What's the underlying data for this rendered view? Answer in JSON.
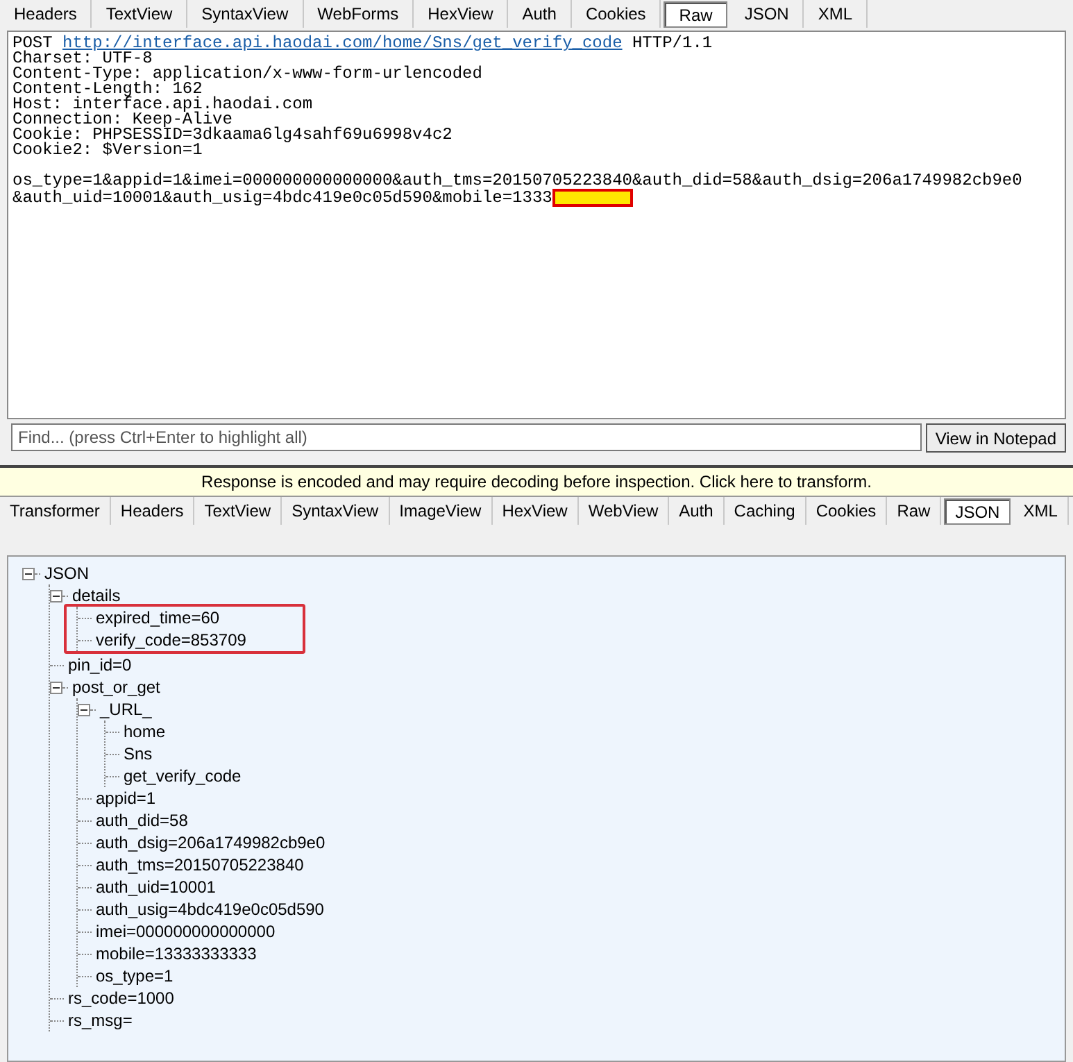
{
  "request_tabs": [
    {
      "label": "Headers",
      "selected": false
    },
    {
      "label": "TextView",
      "selected": false
    },
    {
      "label": "SyntaxView",
      "selected": false
    },
    {
      "label": "WebForms",
      "selected": false
    },
    {
      "label": "HexView",
      "selected": false
    },
    {
      "label": "Auth",
      "selected": false
    },
    {
      "label": "Cookies",
      "selected": false
    },
    {
      "label": "Raw",
      "selected": true
    },
    {
      "label": "JSON",
      "selected": false
    },
    {
      "label": "XML",
      "selected": false
    }
  ],
  "raw_request": {
    "method": "POST",
    "url": "http://interface.api.haodai.com/home/Sns/get_verify_code",
    "protocol": "HTTP/1.1",
    "headers": [
      "Charset: UTF-8",
      "Content-Type: application/x-www-form-urlencoded",
      "Content-Length: 162",
      "Host: interface.api.haodai.com",
      "Connection: Keep-Alive",
      "Cookie: PHPSESSID=3dkaama6lg4sahf69u6998v4c2",
      "Cookie2: $Version=1"
    ],
    "body": [
      "os_type=1&appid=1&imei=000000000000000&auth_tms=20150705223840&auth_did=58&auth_dsig=206a1749982cb9e0",
      "&auth_uid=10001&auth_usig=4bdc419e0c05d590&mobile=1333"
    ],
    "redacted": true
  },
  "find_bar": {
    "placeholder": "Find... (press Ctrl+Enter to highlight all)",
    "button": "View in Notepad"
  },
  "banner": "Response is encoded and may require decoding before inspection. Click here to transform.",
  "response_tabs": [
    {
      "label": "Transformer",
      "selected": false
    },
    {
      "label": "Headers",
      "selected": false
    },
    {
      "label": "TextView",
      "selected": false
    },
    {
      "label": "SyntaxView",
      "selected": false
    },
    {
      "label": "ImageView",
      "selected": false
    },
    {
      "label": "HexView",
      "selected": false
    },
    {
      "label": "WebView",
      "selected": false
    },
    {
      "label": "Auth",
      "selected": false
    },
    {
      "label": "Caching",
      "selected": false
    },
    {
      "label": "Cookies",
      "selected": false
    },
    {
      "label": "Raw",
      "selected": false
    },
    {
      "label": "JSON",
      "selected": true
    },
    {
      "label": "XML",
      "selected": false
    }
  ],
  "json_tree": [
    {
      "label": "JSON",
      "expanded": true,
      "children": [
        {
          "label": "details",
          "expanded": true,
          "framed": true,
          "children": [
            {
              "label": "expired_time=60"
            },
            {
              "label": "verify_code=853709"
            }
          ]
        },
        {
          "label": "pin_id=0"
        },
        {
          "label": "post_or_get",
          "expanded": true,
          "children": [
            {
              "label": "_URL_",
              "expanded": true,
              "children": [
                {
                  "label": "home"
                },
                {
                  "label": "Sns"
                },
                {
                  "label": "get_verify_code"
                }
              ]
            },
            {
              "label": "appid=1"
            },
            {
              "label": "auth_did=58"
            },
            {
              "label": "auth_dsig=206a1749982cb9e0"
            },
            {
              "label": "auth_tms=20150705223840"
            },
            {
              "label": "auth_uid=10001"
            },
            {
              "label": "auth_usig=4bdc419e0c05d590"
            },
            {
              "label": "imei=000000000000000"
            },
            {
              "label": "mobile=13333333333"
            },
            {
              "label": "os_type=1"
            }
          ]
        },
        {
          "label": "rs_code=1000"
        },
        {
          "label": "rs_msg="
        }
      ]
    }
  ]
}
